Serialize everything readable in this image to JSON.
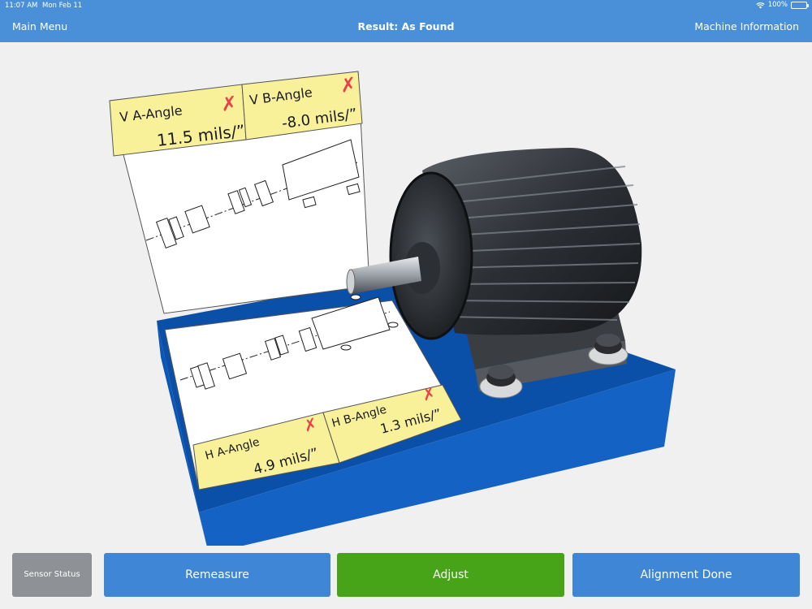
{
  "status_bar": {
    "time": "11:07 AM",
    "date": "Mon Feb 11",
    "battery": "100%"
  },
  "nav": {
    "left": "Main Menu",
    "title": "Result: As Found",
    "right": "Machine Information"
  },
  "panels": {
    "vertical": [
      {
        "label": "V A-Angle",
        "value": "11.5 mils/”"
      },
      {
        "label": "V B-Angle",
        "value": "-8.0 mils/”"
      }
    ],
    "horizontal": [
      {
        "label": "H A-Angle",
        "value": "4.9 mils/”"
      },
      {
        "label": "H B-Angle",
        "value": "1.3 mils/”"
      }
    ],
    "fail_mark": "✗"
  },
  "buttons": {
    "sensor_status": "Sensor Status",
    "remeasure": "Remeasure",
    "adjust": "Adjust",
    "alignment_done": "Alignment Done"
  },
  "colors": {
    "nav_bg": "#4a90d9",
    "panel_yellow": "#f8f19a",
    "base_blue": "#0a4fa8",
    "fail_red": "#e8414a",
    "adjust_green": "#47a317"
  }
}
